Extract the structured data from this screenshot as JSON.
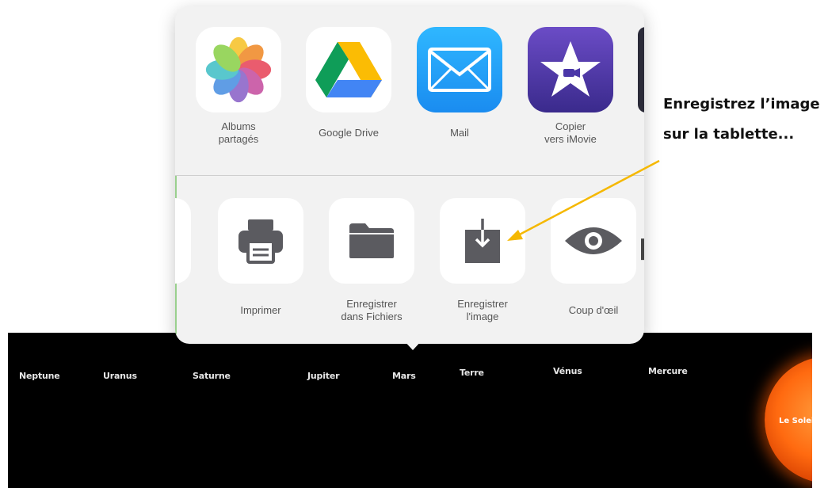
{
  "share_sheet": {
    "apps": [
      {
        "label": "Albums\npartagés",
        "icon": "photos-icon"
      },
      {
        "label": "Google Drive",
        "icon": "google-drive-icon"
      },
      {
        "label": "Mail",
        "icon": "mail-icon"
      },
      {
        "label": "Copier\nvers iMovie",
        "icon": "imovie-icon"
      }
    ],
    "actions": [
      {
        "label": "Imprimer",
        "icon": "printer-icon"
      },
      {
        "label": "Enregistrer\ndans Fichiers",
        "icon": "folder-icon"
      },
      {
        "label": "Enregistrer\nl'image",
        "icon": "save-image-icon"
      },
      {
        "label": "Coup d'œil",
        "icon": "eye-icon"
      }
    ]
  },
  "annotation": {
    "line1": "Enregistrez l’image",
    "line2": "sur la tablette...",
    "arrow_color": "#f5b800"
  },
  "background_image": {
    "planets": [
      "Neptune",
      "Uranus",
      "Saturne",
      "Jupiter",
      "Mars",
      "Terre",
      "Vénus",
      "Mercure"
    ],
    "sun_label": "Le Soleil"
  }
}
